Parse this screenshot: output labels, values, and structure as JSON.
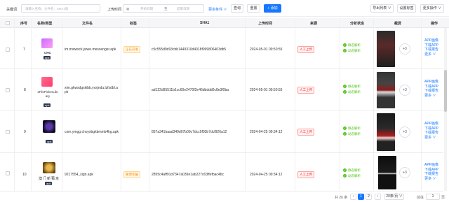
{
  "toolbar": {
    "keyword_label": "关键词",
    "keyword_placeholder": "请输入名称、文件名、SHA1值",
    "time_label": "上传时间",
    "start_placeholder": "开始日期",
    "range_sep": "至",
    "end_placeholder": "结束日期",
    "more_label": "更多条件 ∨",
    "query_label": "查询",
    "reset_label": "重置",
    "add_label": "+ 添加",
    "export_label": "导出列表 ∨",
    "set_tag_label": "设置标签",
    "more_ops_label": "更多操作 ∨"
  },
  "columns": [
    "序号",
    "名称/类型",
    "文件名",
    "标签",
    "SHA1",
    "上传时间",
    "来源",
    "分析状态",
    "截屏",
    "操作"
  ],
  "rows": [
    {
      "index": "7",
      "name": "CHC",
      "type": "apk",
      "icon_color": "#9b59f5",
      "filename": "im.mwwsck.jwwe.messenger.apk",
      "tag": "正在开发",
      "sha1": "c5c555d9d93cbb1449310d4018f999806403db5",
      "time": "2024-05-01 09:50:55",
      "source": "人工上传",
      "status1": "静态解析",
      "status2": "动态解析",
      "more_shots": "+3",
      "ops": [
        "APP画像",
        "下载APP",
        "下载报告",
        "更多 ∨"
      ]
    },
    {
      "index": "8",
      "name": "1FilePickerLibrary",
      "type": "apk",
      "icon_color": "#ff4d6d",
      "filename": "xim.gkwsdgsikbb.yxsjndu.lzfsdbl.apk",
      "tag": "",
      "sha1": "ad122d95511b1cc60e2470f2e46dbddd0c8e3f0ba",
      "time": "2024-05-01 09:50:55",
      "source": "人工上传",
      "status1": "静态解析",
      "status2": "动态解析",
      "more_shots": "+3",
      "ops": [
        "APP画像",
        "下载APP",
        "下载报告",
        "更多 ∨"
      ]
    },
    {
      "index": "9",
      "name": "",
      "type": "apk",
      "icon_color": "#1a1a3a",
      "filename": "com.ymgg.choyxbgkbmmb4kg.apk",
      "tag": "",
      "sha1": "857a341baad349d07b09c7dcc9f03b7dcf926a12",
      "time": "2024-04-25 09:34:12",
      "source": "人工上传",
      "status1": "静态解析",
      "status2": "动态解析",
      "more_shots": "+3",
      "ops": [
        "APP画像",
        "下载APP",
        "下载报告",
        "更多 ∨"
      ]
    },
    {
      "index": "10",
      "name": "澳门新葡京",
      "type": "apk",
      "icon_color": "#c89b2b",
      "filename": "9217554_sign.apk",
      "tag": "赌博诈骗",
      "sha1": "2855c4aff91d7347a039e1ab227c63ffefbac4bc",
      "time": "2024-04-25 09:34:12",
      "source": "人工上传",
      "status1": "静态解析",
      "status2": "动态解析",
      "more_shots": "+3",
      "ops": [
        "APP画像",
        "下载APP",
        "下载报告",
        "更多 ∨"
      ]
    }
  ],
  "pagination": {
    "total": "共 26 条",
    "prev": "‹",
    "pages": [
      "1",
      "2",
      "3"
    ],
    "current": "1",
    "next": "›",
    "page_size": "20条/页 ∨",
    "goto_label": "前往",
    "goto_value": "1",
    "page_suffix": "页"
  },
  "colors": {
    "primary": "#1677ff",
    "success": "#52c41a",
    "warning": "#fa8c16"
  }
}
